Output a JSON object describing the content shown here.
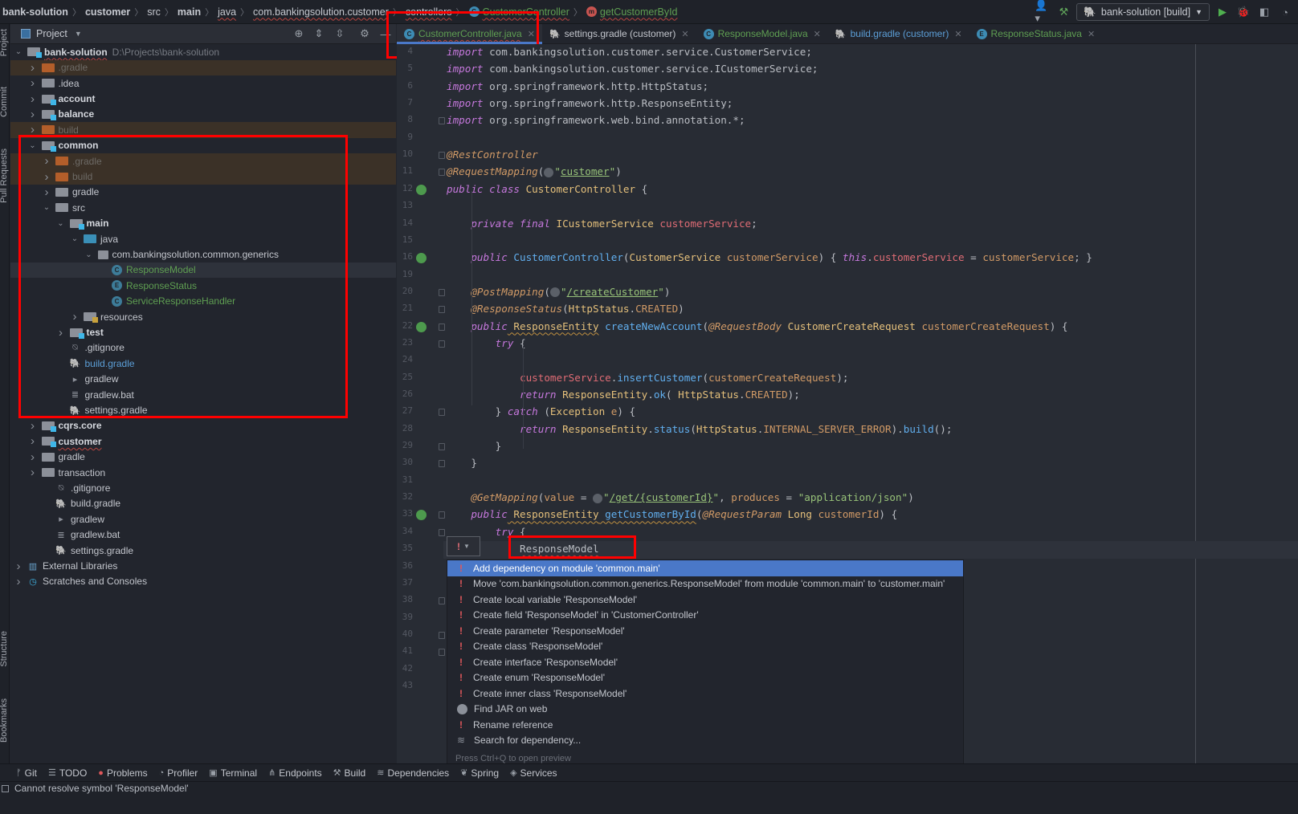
{
  "navbar": {
    "breadcrumbs": [
      {
        "label": "bank-solution",
        "bold": true
      },
      {
        "label": "customer",
        "bold": true
      },
      {
        "label": "src"
      },
      {
        "label": "main",
        "bold": true
      },
      {
        "label": "java",
        "squiggle": true
      },
      {
        "label": "com.bankingsolution.customer",
        "squiggle": true
      },
      {
        "label": "controllers",
        "squiggle": true
      },
      {
        "label": "CustomerController",
        "icon": "class-icon",
        "green": true,
        "squiggle": true
      },
      {
        "label": "getCustomerById",
        "icon": "method-icon",
        "green": true,
        "squiggle": true
      }
    ],
    "run_config": "bank-solution [build]"
  },
  "left_strip": [
    "Project",
    "Commit",
    "Pull Requests",
    "Structure",
    "Bookmarks"
  ],
  "project": {
    "title": "Project",
    "tree": [
      {
        "label": "bank-solution",
        "depth": 0,
        "chev": "down",
        "folder": "grey",
        "module": true,
        "bold": true,
        "squiggle": true,
        "suffix": "D:\\Projects\\bank-solution"
      },
      {
        "label": ".gradle",
        "depth": 1,
        "chev": "right",
        "folder": "orange",
        "excluded": true
      },
      {
        "label": ".idea",
        "depth": 1,
        "chev": "right",
        "folder": "grey"
      },
      {
        "label": "account",
        "depth": 1,
        "chev": "right",
        "folder": "grey",
        "module": true,
        "bold": true
      },
      {
        "label": "balance",
        "depth": 1,
        "chev": "right",
        "folder": "grey",
        "module": true,
        "bold": true
      },
      {
        "label": "build",
        "depth": 1,
        "chev": "right",
        "folder": "orange",
        "excluded": true
      },
      {
        "label": "common",
        "depth": 1,
        "chev": "down",
        "folder": "grey",
        "module": true,
        "bold": true
      },
      {
        "label": ".gradle",
        "depth": 2,
        "chev": "right",
        "folder": "orange",
        "excluded": true
      },
      {
        "label": "build",
        "depth": 2,
        "chev": "right",
        "folder": "orange",
        "excluded": true
      },
      {
        "label": "gradle",
        "depth": 2,
        "chev": "right",
        "folder": "grey"
      },
      {
        "label": "src",
        "depth": 2,
        "chev": "down",
        "folder": "grey"
      },
      {
        "label": "main",
        "depth": 3,
        "chev": "down",
        "folder": "grey",
        "module": true,
        "bold": true
      },
      {
        "label": "java",
        "depth": 4,
        "chev": "down",
        "folder": "blue"
      },
      {
        "label": "com.bankingsolution.common.generics",
        "depth": 5,
        "chev": "down",
        "folder": "package"
      },
      {
        "label": "ResponseModel",
        "depth": 6,
        "file": "class",
        "green": true,
        "selected": true
      },
      {
        "label": "ResponseStatus",
        "depth": 6,
        "file": "enum",
        "green": true
      },
      {
        "label": "ServiceResponseHandler",
        "depth": 6,
        "file": "class",
        "green": true
      },
      {
        "label": "resources",
        "depth": 4,
        "chev": "right",
        "folder": "resources"
      },
      {
        "label": "test",
        "depth": 3,
        "chev": "right",
        "folder": "grey",
        "module": true,
        "bold": true
      },
      {
        "label": ".gitignore",
        "depth": 3,
        "file": "gitignore"
      },
      {
        "label": "build.gradle",
        "depth": 3,
        "file": "gradle",
        "blue": true
      },
      {
        "label": "gradlew",
        "depth": 3,
        "file": "shell"
      },
      {
        "label": "gradlew.bat",
        "depth": 3,
        "file": "text"
      },
      {
        "label": "settings.gradle",
        "depth": 3,
        "file": "gradle"
      },
      {
        "label": "cqrs.core",
        "depth": 1,
        "chev": "right",
        "folder": "grey",
        "module": true,
        "bold": true
      },
      {
        "label": "customer",
        "depth": 1,
        "chev": "right",
        "folder": "grey",
        "module": true,
        "bold": true,
        "squiggle": true
      },
      {
        "label": "gradle",
        "depth": 1,
        "chev": "right",
        "folder": "grey"
      },
      {
        "label": "transaction",
        "depth": 1,
        "chev": "right",
        "folder": "grey"
      },
      {
        "label": ".gitignore",
        "depth": 2,
        "file": "gitignore"
      },
      {
        "label": "build.gradle",
        "depth": 2,
        "file": "gradle"
      },
      {
        "label": "gradlew",
        "depth": 2,
        "file": "shell"
      },
      {
        "label": "gradlew.bat",
        "depth": 2,
        "file": "text"
      },
      {
        "label": "settings.gradle",
        "depth": 2,
        "file": "gradle"
      },
      {
        "label": "External Libraries",
        "depth": 0,
        "chev": "right",
        "file": "libraries"
      },
      {
        "label": "Scratches and Consoles",
        "depth": 0,
        "chev": "right",
        "file": "scratches"
      }
    ]
  },
  "tabs": [
    {
      "label": "CustomerController.java",
      "icon": "C",
      "active": true,
      "color": "green",
      "squiggle": true
    },
    {
      "label": "settings.gradle (customer)",
      "icon": "gradle"
    },
    {
      "label": "ResponseModel.java",
      "icon": "C",
      "color": "green"
    },
    {
      "label": "build.gradle (customer)",
      "icon": "gradle",
      "color": "blue"
    },
    {
      "label": "ResponseStatus.java",
      "icon": "E",
      "color": "green"
    }
  ],
  "editor": {
    "line_numbers": [
      "4",
      "5",
      "6",
      "7",
      "8",
      "9",
      "10",
      "11",
      "12",
      "13",
      "14",
      "15",
      "16",
      "19",
      "20",
      "21",
      "22",
      "23",
      "24",
      "25",
      "26",
      "27",
      "28",
      "29",
      "30",
      "31",
      "32",
      "33",
      "34",
      "35",
      "36",
      "37",
      "38",
      "39",
      "40",
      "41",
      "42",
      "43"
    ],
    "typed_symbol": "ResponseModel"
  },
  "intention_popup": {
    "items": [
      {
        "label": "Add dependency on module 'common.main'",
        "icon": "error-bulb",
        "selected": true
      },
      {
        "label": "Move 'com.bankingsolution.common.generics.ResponseModel' from module 'common.main' to 'customer.main'",
        "icon": "error-bulb"
      },
      {
        "label": "Create local variable 'ResponseModel'",
        "icon": "error-bulb"
      },
      {
        "label": "Create field 'ResponseModel' in 'CustomerController'",
        "icon": "error-bulb"
      },
      {
        "label": "Create parameter 'ResponseModel'",
        "icon": "error-bulb"
      },
      {
        "label": "Create class 'ResponseModel'",
        "icon": "error-bulb"
      },
      {
        "label": "Create interface 'ResponseModel'",
        "icon": "error-bulb"
      },
      {
        "label": "Create enum 'ResponseModel'",
        "icon": "error-bulb"
      },
      {
        "label": "Create inner class 'ResponseModel'",
        "icon": "error-bulb"
      },
      {
        "label": "Find JAR on web",
        "icon": "globe"
      },
      {
        "label": "Rename reference",
        "icon": "error-bulb"
      },
      {
        "label": "Search for dependency...",
        "icon": "stack"
      }
    ],
    "footer": "Press Ctrl+Q to open preview"
  },
  "bottom_tools": [
    {
      "label": "Git",
      "icon": "git-icon",
      "glyph": "ᚠ"
    },
    {
      "label": "TODO",
      "icon": "list-icon",
      "glyph": "☰"
    },
    {
      "label": "Problems",
      "icon": "problems-icon",
      "glyph": "●"
    },
    {
      "label": "Profiler",
      "icon": "profiler-icon",
      "glyph": "◔"
    },
    {
      "label": "Terminal",
      "icon": "terminal-icon",
      "glyph": "▣"
    },
    {
      "label": "Endpoints",
      "icon": "endpoints-icon",
      "glyph": "⋔"
    },
    {
      "label": "Build",
      "icon": "hammer-icon",
      "glyph": "⚒"
    },
    {
      "label": "Dependencies",
      "icon": "stack-icon",
      "glyph": "≋"
    },
    {
      "label": "Spring",
      "icon": "spring-icon",
      "glyph": "❦"
    },
    {
      "label": "Services",
      "icon": "services-icon",
      "glyph": "◈"
    }
  ],
  "status": {
    "message": "Cannot resolve symbol 'ResponseModel'"
  },
  "colors": {
    "accent": "#4a78c8",
    "highlight_box": "#ff0000",
    "error": "#e0575b"
  }
}
